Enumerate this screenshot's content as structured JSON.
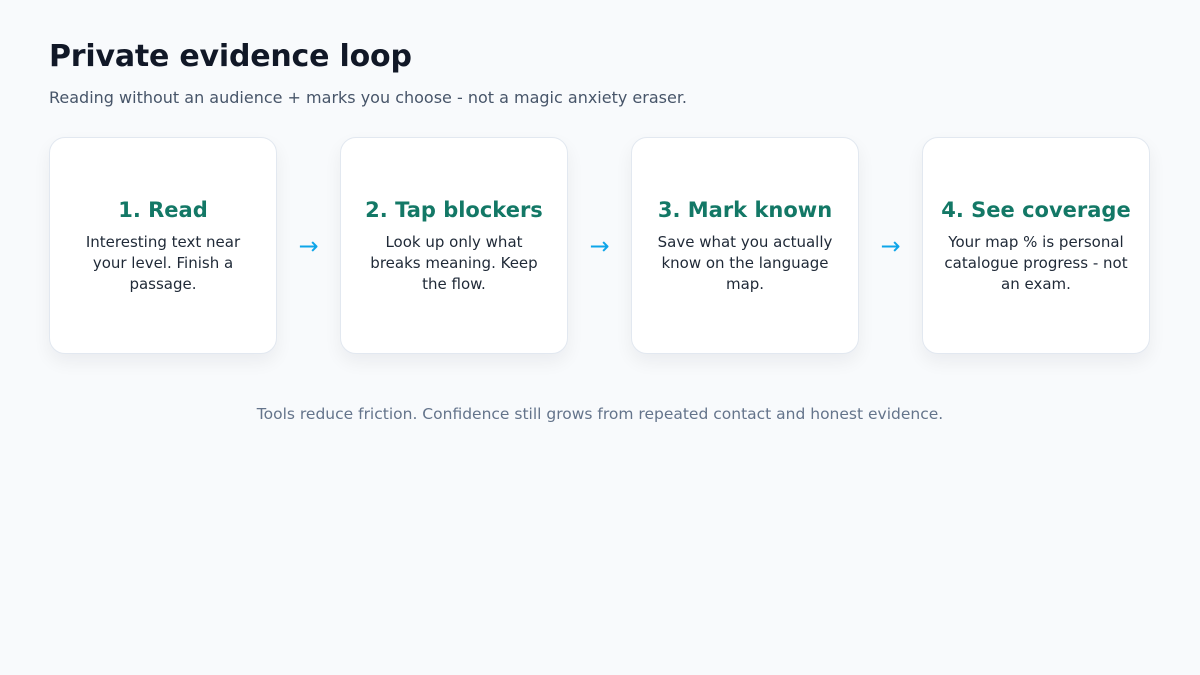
{
  "header": {
    "title": "Private evidence loop",
    "subtitle": "Reading without an audience + marks you choose - not a magic anxiety eraser."
  },
  "steps": [
    {
      "title": "1. Read",
      "body": "Interesting text near your level. Finish a passage."
    },
    {
      "title": "2. Tap blockers",
      "body": "Look up only what breaks meaning. Keep the flow."
    },
    {
      "title": "3. Mark known",
      "body": "Save what you actually know on the language map."
    },
    {
      "title": "4. See coverage",
      "body": "Your map % is personal catalogue progress - not an exam."
    }
  ],
  "arrow_glyph": "→",
  "footer": {
    "note": "Tools reduce friction. Confidence still grows from repeated contact and honest evidence."
  },
  "colors": {
    "background": "#f8fafc",
    "step_title": "#137866",
    "arrow": "#0ea5e9",
    "card_border": "#e2e8f0"
  }
}
